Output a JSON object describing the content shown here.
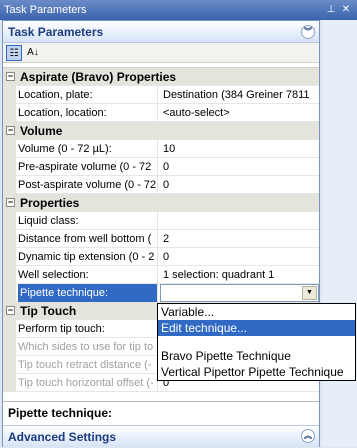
{
  "window": {
    "title": "Task Parameters"
  },
  "panel": {
    "title": "Task Parameters"
  },
  "toolbar": {
    "categorized_icon": "categorized-icon",
    "alpha_icon": "alphabetical-sort-icon"
  },
  "grid": {
    "sections": [
      {
        "title": "Aspirate (Bravo) Properties",
        "rows": [
          {
            "name": "Location, plate:",
            "value": "Destination  (384 Greiner 7811"
          },
          {
            "name": "Location, location:",
            "value": "<auto-select>"
          }
        ]
      },
      {
        "title": "Volume",
        "rows": [
          {
            "name": "Volume (0 - 72 µL):",
            "value": "10"
          },
          {
            "name": "Pre-aspirate volume (0 - 72",
            "value": "0"
          },
          {
            "name": "Post-aspirate volume (0 - 72",
            "value": "0"
          }
        ]
      },
      {
        "title": "Properties",
        "rows": [
          {
            "name": "Liquid class:",
            "value": ""
          },
          {
            "name": "Distance from well bottom (",
            "value": "2"
          },
          {
            "name": "Dynamic tip extension (0 - 2",
            "value": "0"
          },
          {
            "name": "Well selection:",
            "value": "1 selection: quadrant 1"
          },
          {
            "name": "Pipette technique:",
            "value": ""
          }
        ]
      },
      {
        "title": "Tip Touch",
        "rows": [
          {
            "name": "Perform tip touch:",
            "value": ""
          },
          {
            "name": "Which sides to use for tip to",
            "value": ""
          },
          {
            "name": "Tip touch retract distance (-",
            "value": ""
          },
          {
            "name": "Tip touch horizontal offset (-",
            "value": "0"
          }
        ]
      }
    ]
  },
  "dropdown": {
    "items": [
      "Variable...",
      "Edit technique...",
      "Bravo Pipette Technique",
      "Vertical Pipettor Pipette Technique"
    ]
  },
  "description": {
    "title": "Pipette technique:"
  },
  "advanced": {
    "title": "Advanced Settings"
  }
}
